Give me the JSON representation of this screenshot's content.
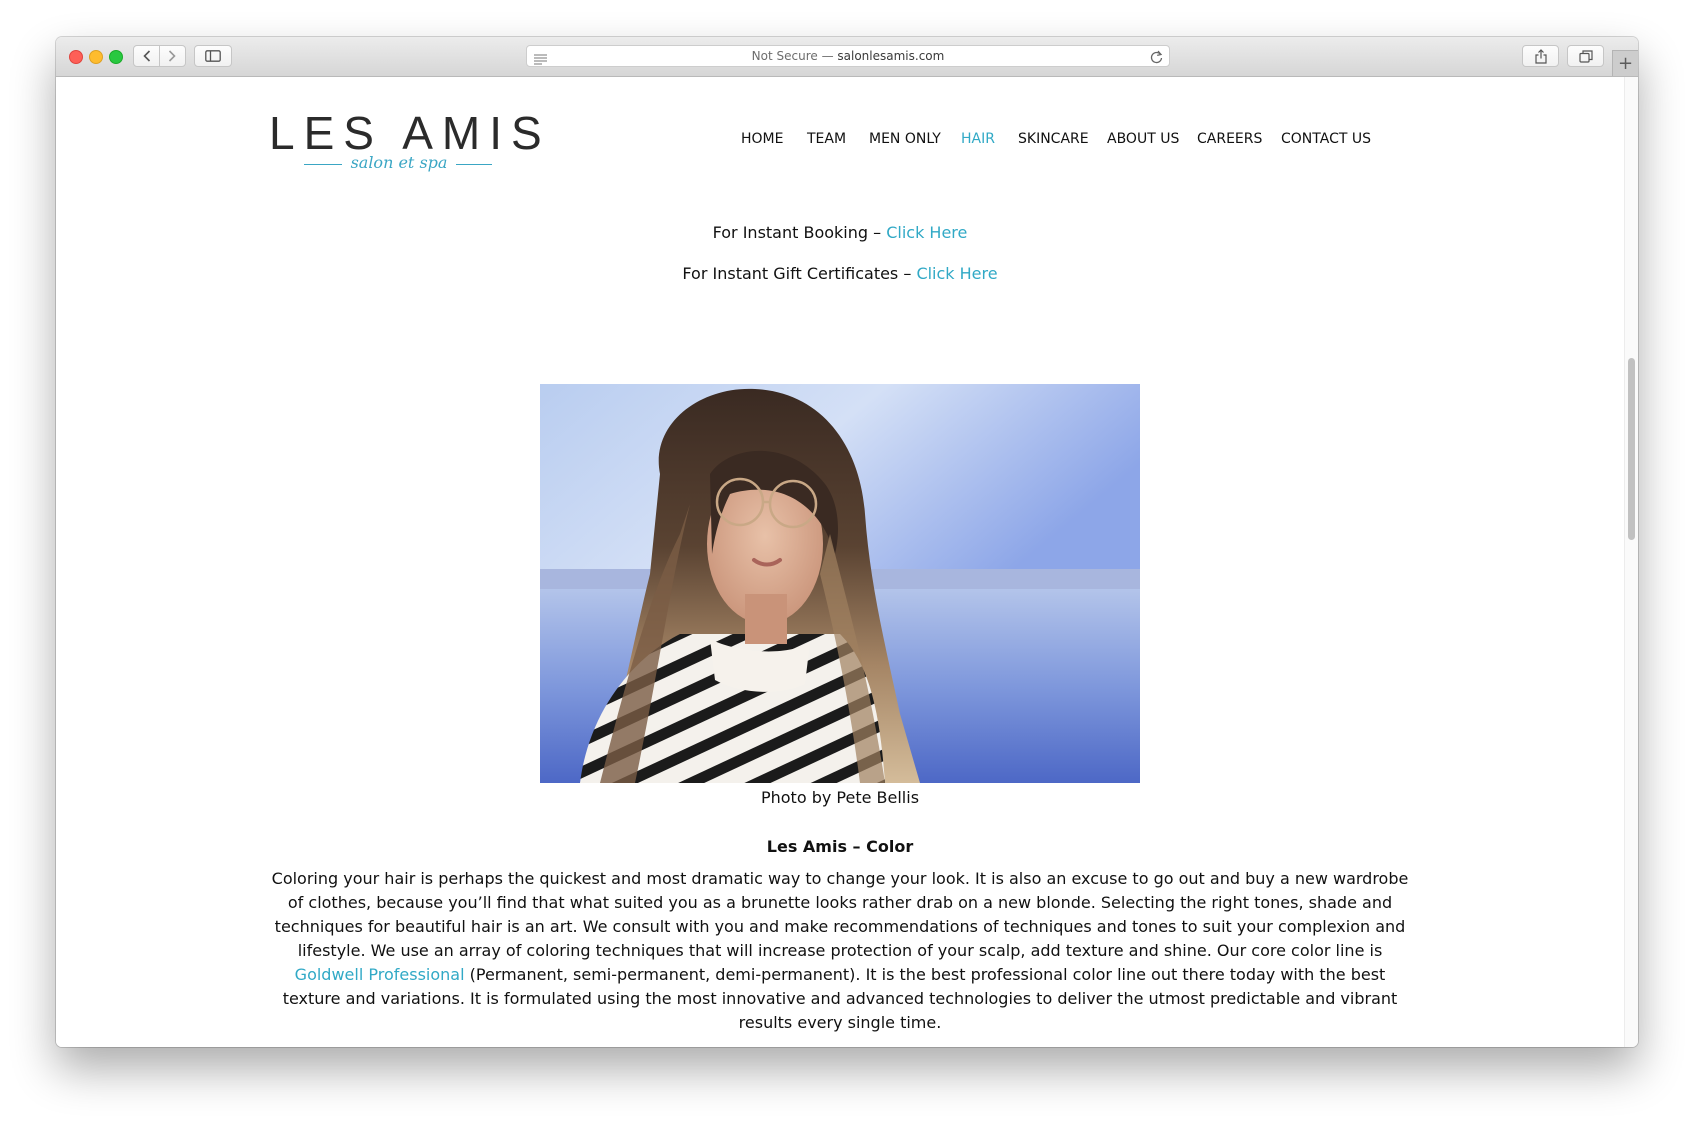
{
  "browser": {
    "security_label": "Not Secure",
    "separator": " — ",
    "host": "salonlesamis.com",
    "new_tab_symbol": "+"
  },
  "logo": {
    "main": "LES AMIS",
    "sub": "salon et spa"
  },
  "nav": {
    "items": [
      {
        "label": "HOME",
        "active": false
      },
      {
        "label": "TEAM",
        "active": false
      },
      {
        "label": "MEN ONLY",
        "active": false
      },
      {
        "label": "HAIR",
        "active": true
      },
      {
        "label": "SKINCARE",
        "active": false
      },
      {
        "label": "ABOUT US",
        "active": false
      },
      {
        "label": "CAREERS",
        "active": false
      },
      {
        "label": "CONTACT US",
        "active": false
      }
    ]
  },
  "booking": {
    "prefix": "For Instant Booking – ",
    "link": "Click Here"
  },
  "gift": {
    "prefix": "For Instant Gift Certificates – ",
    "link": "Click Here"
  },
  "photo": {
    "caption": "Photo by Pete Bellis"
  },
  "section": {
    "heading": "Les Amis – Color",
    "text_before": "Coloring your hair is perhaps the quickest and most dramatic way to change your look. It is also an excuse to go out and buy a new wardrobe of clothes, because you’ll find that what suited you as a brunette looks rather drab on a new blonde. Selecting the right tones, shade and techniques for beautiful hair is an art. We consult with you and make recommendations of techniques and tones to suit your complexion and lifestyle. We use an array of coloring techniques that will increase protection of your scalp, add texture and shine. Our core color line is ",
    "link": "Goldwell Professional",
    "text_after": " (Permanent, semi-permanent, demi-permanent). It is the best professional color line out there today with the best texture and variations. It is formulated using the most innovative and advanced technologies to deliver the utmost predictable and vibrant results every single time."
  },
  "colors": {
    "accent": "#31a9c6",
    "text": "#111111"
  }
}
